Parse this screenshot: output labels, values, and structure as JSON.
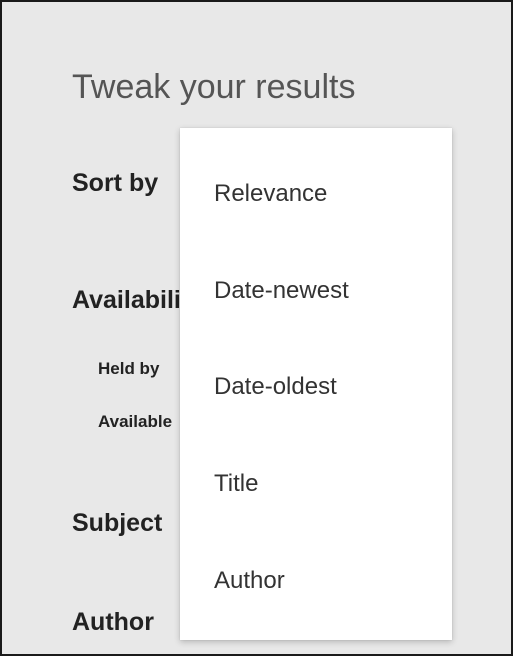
{
  "panel": {
    "title": "Tweak your results"
  },
  "sections": {
    "sort_by": "Sort by",
    "availability": "Availability",
    "subject": "Subject",
    "author": "Author"
  },
  "availability_items": {
    "held_by": "Held by",
    "available": "Available"
  },
  "sort_dropdown": {
    "options": [
      "Relevance",
      "Date-newest",
      "Date-oldest",
      "Title",
      "Author"
    ]
  }
}
